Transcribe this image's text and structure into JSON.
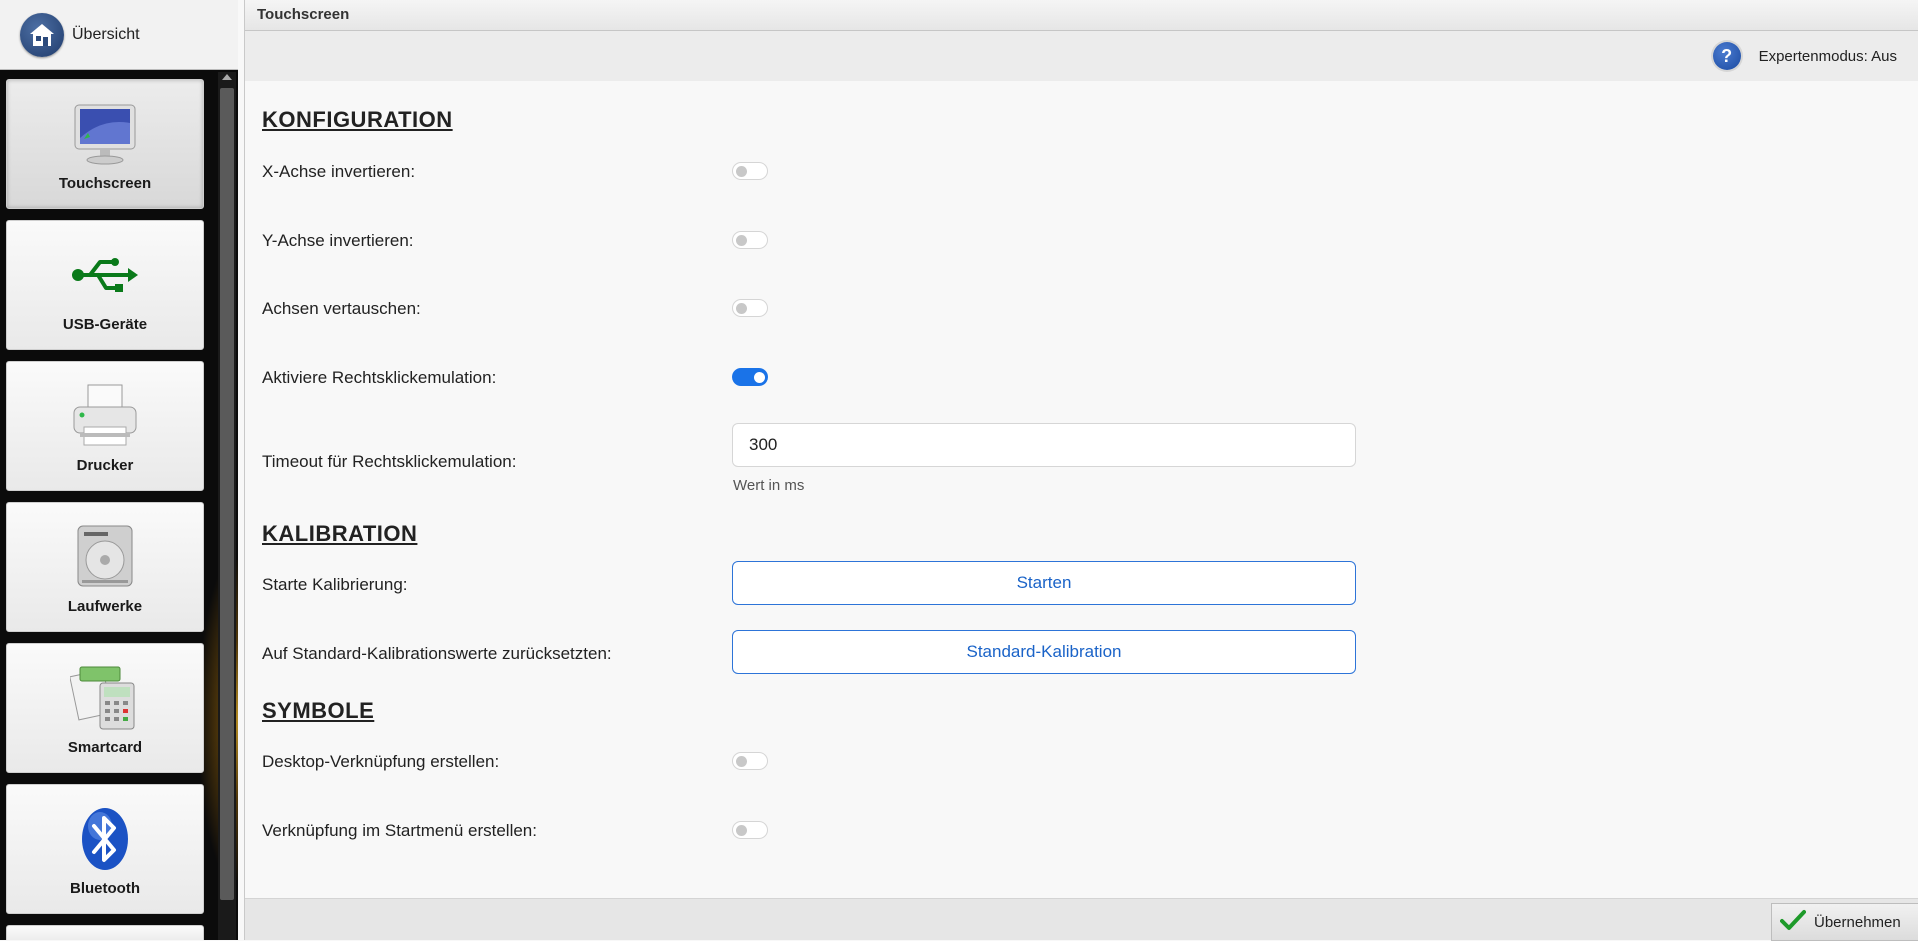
{
  "home": {
    "label": "Übersicht",
    "icon": "home-icon"
  },
  "sidebar": {
    "items": [
      {
        "label": "Touchscreen",
        "icon": "monitor-icon",
        "active": true
      },
      {
        "label": "USB-Geräte",
        "icon": "usb-icon",
        "active": false
      },
      {
        "label": "Drucker",
        "icon": "printer-icon",
        "active": false
      },
      {
        "label": "Laufwerke",
        "icon": "hard-drive-icon",
        "active": false
      },
      {
        "label": "Smartcard",
        "icon": "smartcard-icon",
        "active": false
      },
      {
        "label": "Bluetooth",
        "icon": "bluetooth-icon",
        "active": false
      }
    ]
  },
  "header": {
    "title": "Touchscreen",
    "expert_mode": "Expertenmodus: Aus",
    "help_symbol": "?"
  },
  "sections": {
    "config": {
      "title": "KONFIGURATION",
      "invert_x": {
        "label": "X-Achse invertieren:",
        "on": false
      },
      "invert_y": {
        "label": "Y-Achse invertieren:",
        "on": false
      },
      "swap_axes": {
        "label": "Achsen vertauschen:",
        "on": false
      },
      "right_click": {
        "label": "Aktiviere Rechtsklickemulation:",
        "on": true
      },
      "timeout": {
        "label": "Timeout für Rechtsklickemulation:",
        "value": "300",
        "hint": "Wert in ms"
      }
    },
    "calibration": {
      "title": "KALIBRATION",
      "start": {
        "label": "Starte Kalibrierung:",
        "button": "Starten"
      },
      "reset": {
        "label": "Auf Standard-Kalibrationswerte zurücksetzten:",
        "button": "Standard-Kalibration"
      }
    },
    "symbols": {
      "title": "SYMBOLE",
      "desktop": {
        "label": "Desktop-Verknüpfung erstellen:",
        "on": false
      },
      "startmenu": {
        "label": "Verknüpfung im Startmenü erstellen:",
        "on": false
      }
    }
  },
  "footer": {
    "apply": "Übernehmen",
    "icon": "checkmark-icon"
  },
  "colors": {
    "accent": "#1a73e8",
    "button_text": "#1a63c8",
    "sidebar_bg": "#0b0b0b"
  }
}
